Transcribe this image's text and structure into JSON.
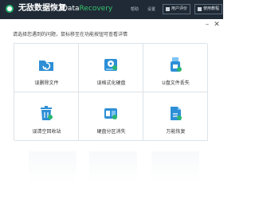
{
  "app": {
    "title": "无敌数据恢复",
    "brand_primary": "Data",
    "brand_secondary": "Recovery",
    "brand_color": "#37c36c",
    "titlebar_color": "#1f2a36"
  },
  "titlebar": {
    "links": [
      "帮助",
      "设置"
    ],
    "buttons": [
      {
        "label": "用户评价",
        "icon": "chat-icon"
      },
      {
        "label": "使用教程",
        "icon": "book-icon"
      }
    ],
    "controls": [
      "minimize",
      "close"
    ]
  },
  "prompt": "请选择您遇到的问题，鼠标移至在功能按钮可查看详情",
  "options": [
    {
      "label": "误删除文件",
      "icon": "folder-icon"
    },
    {
      "label": "误格式化硬盘",
      "icon": "disk-format-icon"
    },
    {
      "label": "U盘文件丢失",
      "icon": "usb-drive-icon"
    },
    {
      "label": "误清空回收站",
      "icon": "recycle-bin-icon"
    },
    {
      "label": "硬盘分区消失",
      "icon": "partition-icon"
    },
    {
      "label": "万能恢复",
      "icon": "universal-restore-icon"
    }
  ]
}
